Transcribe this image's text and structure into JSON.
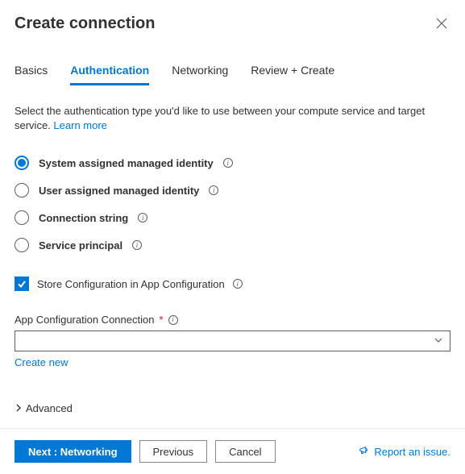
{
  "header": {
    "title": "Create connection"
  },
  "tabs": [
    {
      "label": "Basics",
      "active": false
    },
    {
      "label": "Authentication",
      "active": true
    },
    {
      "label": "Networking",
      "active": false
    },
    {
      "label": "Review + Create",
      "active": false
    }
  ],
  "description": {
    "text": "Select the authentication type you'd like to use between your compute service and target service.",
    "learn_more": "Learn more"
  },
  "auth_options": [
    {
      "label": "System assigned managed identity",
      "selected": true
    },
    {
      "label": "User assigned managed identity",
      "selected": false
    },
    {
      "label": "Connection string",
      "selected": false
    },
    {
      "label": "Service principal",
      "selected": false
    }
  ],
  "store_config": {
    "label": "Store Configuration in App Configuration",
    "checked": true
  },
  "app_config": {
    "label": "App Configuration Connection",
    "required_marker": "*",
    "create_new": "Create new"
  },
  "advanced": {
    "label": "Advanced"
  },
  "footer": {
    "next": "Next : Networking",
    "previous": "Previous",
    "cancel": "Cancel",
    "report": "Report an issue."
  }
}
